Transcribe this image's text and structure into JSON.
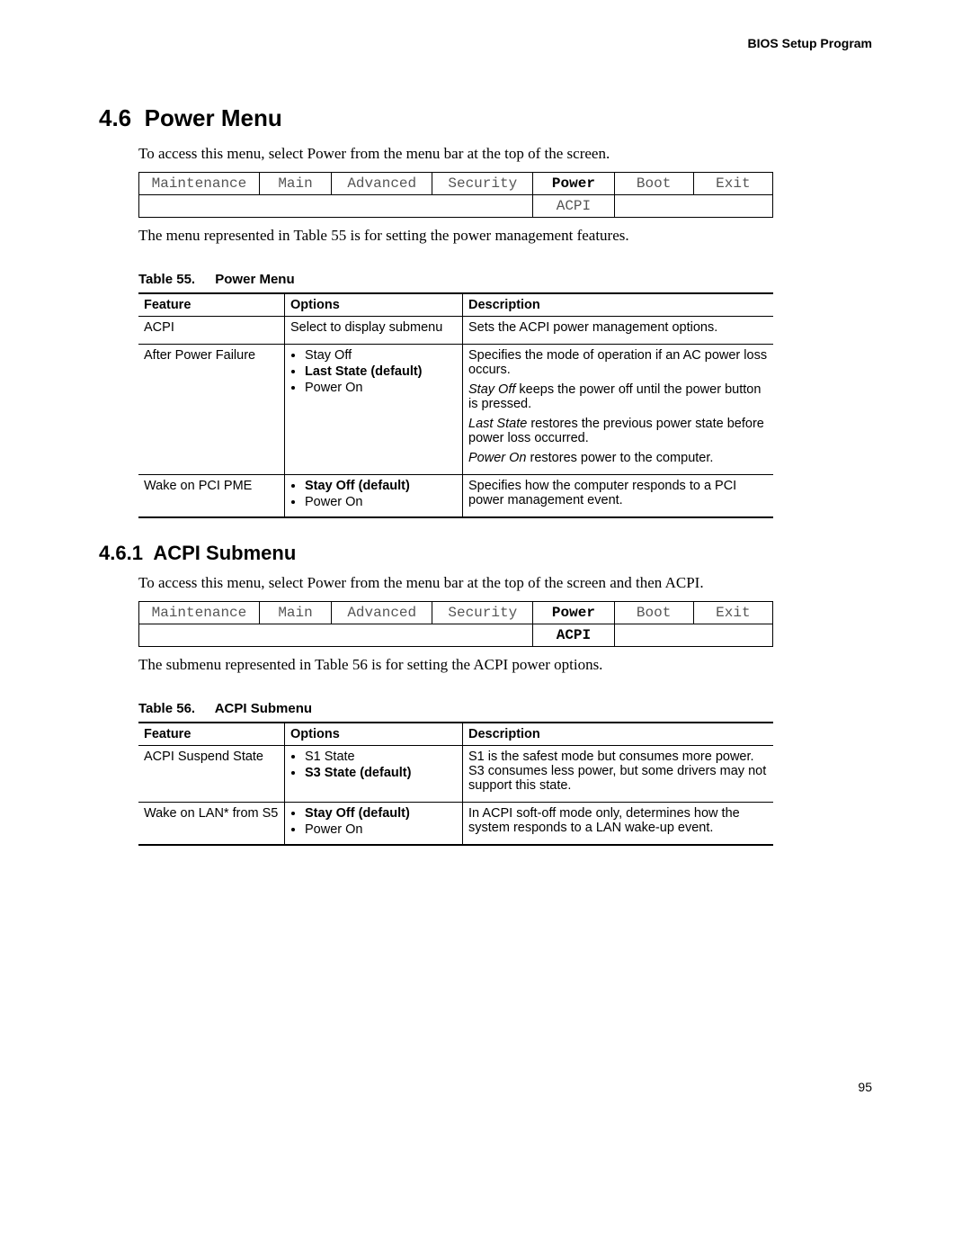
{
  "header": {
    "running": "BIOS Setup Program"
  },
  "section1": {
    "number": "4.6",
    "title": "Power Menu",
    "intro": "To access this menu, select Power from the menu bar at the top of the screen.",
    "aftermenu": "The menu represented in Table 55 is for setting the power management features."
  },
  "menubar1": {
    "items": [
      "Maintenance",
      "Main",
      "Advanced",
      "Security",
      "Power",
      "Boot",
      "Exit"
    ],
    "active_index": 4,
    "sub": "ACPI",
    "sub_bold": false
  },
  "table55": {
    "cap_num": "Table 55.",
    "cap_title": "Power Menu",
    "headers": [
      "Feature",
      "Options",
      "Description"
    ],
    "rows": [
      {
        "feature": "ACPI",
        "options_plain": "Select to display submenu",
        "desc": [
          {
            "text": "Sets the ACPI power management options."
          }
        ]
      },
      {
        "feature": "After Power Failure",
        "options_list": [
          {
            "text": "Stay Off",
            "bold": false
          },
          {
            "text": "Last State (default)",
            "bold": true
          },
          {
            "text": "Power On",
            "bold": false
          }
        ],
        "desc": [
          {
            "text": "Specifies the mode of operation if an AC power loss occurs."
          },
          {
            "lead_ital": "Stay Off",
            "rest": " keeps the power off until the power button is pressed."
          },
          {
            "lead_ital": "Last State",
            "rest": " restores the previous power state before power loss occurred."
          },
          {
            "lead_ital": "Power On",
            "rest": " restores power to the computer."
          }
        ]
      },
      {
        "feature": "Wake on PCI PME",
        "options_list": [
          {
            "text": "Stay Off (default)",
            "bold": true
          },
          {
            "text": "Power On",
            "bold": false
          }
        ],
        "desc": [
          {
            "text": "Specifies how the computer responds to a PCI power management event."
          }
        ]
      }
    ]
  },
  "section2": {
    "number": "4.6.1",
    "title": "ACPI Submenu",
    "intro": "To access this menu, select Power from the menu bar at the top of the screen and then ACPI.",
    "aftermenu": "The submenu represented in Table 56 is for setting the ACPI power options."
  },
  "menubar2": {
    "items": [
      "Maintenance",
      "Main",
      "Advanced",
      "Security",
      "Power",
      "Boot",
      "Exit"
    ],
    "active_index": 4,
    "sub": "ACPI",
    "sub_bold": true
  },
  "table56": {
    "cap_num": "Table 56.",
    "cap_title": "ACPI Submenu",
    "headers": [
      "Feature",
      "Options",
      "Description"
    ],
    "rows": [
      {
        "feature": "ACPI Suspend State",
        "options_list": [
          {
            "text": "S1 State",
            "bold": false
          },
          {
            "text": "S3 State (default)",
            "bold": true
          }
        ],
        "desc": [
          {
            "text": "S1 is the safest mode but consumes more power. S3 consumes less power, but some drivers may not support this state."
          }
        ]
      },
      {
        "feature": "Wake on LAN* from S5",
        "options_list": [
          {
            "text": "Stay Off (default)",
            "bold": true
          },
          {
            "text": "Power On",
            "bold": false
          }
        ],
        "desc": [
          {
            "text": "In ACPI soft-off mode only, determines how the system responds to a LAN wake-up event."
          }
        ]
      }
    ]
  },
  "pagenum": "95"
}
